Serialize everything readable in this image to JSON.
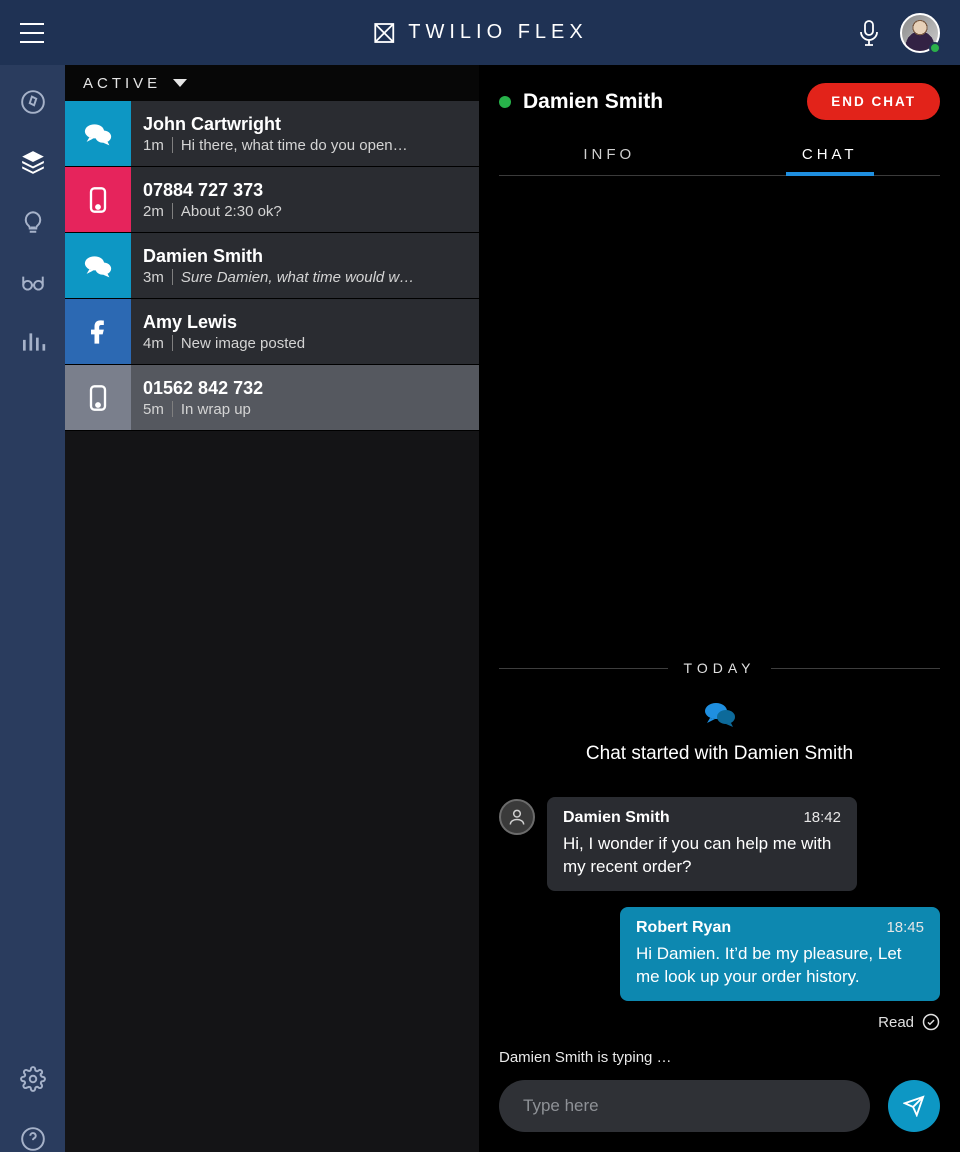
{
  "brand": "TWILIO FLEX",
  "tasks_header": "ACTIVE",
  "items": [
    {
      "name": "John Cartwright",
      "time": "1m",
      "preview": "Hi there, what time do you open…",
      "channel": "chat",
      "color": "c-blue",
      "italic": false
    },
    {
      "name": "07884 727 373",
      "time": "2m",
      "preview": "About 2:30 ok?",
      "channel": "voice",
      "color": "c-pink",
      "italic": false
    },
    {
      "name": "Damien Smith",
      "time": "3m",
      "preview": "Sure Damien, what time would w…",
      "channel": "chat",
      "color": "c-blue",
      "italic": true
    },
    {
      "name": "Amy Lewis",
      "time": "4m",
      "preview": "New image posted",
      "channel": "facebook",
      "color": "c-fb",
      "italic": false
    },
    {
      "name": "01562 842 732",
      "time": "5m",
      "preview": "In wrap up",
      "channel": "voice",
      "color": "wrap",
      "italic": false
    }
  ],
  "convo": {
    "name": "Damien Smith",
    "end_label": "END CHAT",
    "tabs": {
      "info": "INFO",
      "chat": "CHAT"
    },
    "divider": "TODAY",
    "started": "Chat started with Damien Smith",
    "messages": [
      {
        "from": "Damien Smith",
        "time": "18:42",
        "text": "Hi, I wonder if you can help me with my recent order?",
        "me": false
      },
      {
        "from": "Robert Ryan",
        "time": "18:45",
        "text": "Hi Damien. It’d be my pleasure, Let me look up your order history.",
        "me": true
      }
    ],
    "read_label": "Read",
    "typing": "Damien Smith is typing …",
    "placeholder": "Type here"
  }
}
